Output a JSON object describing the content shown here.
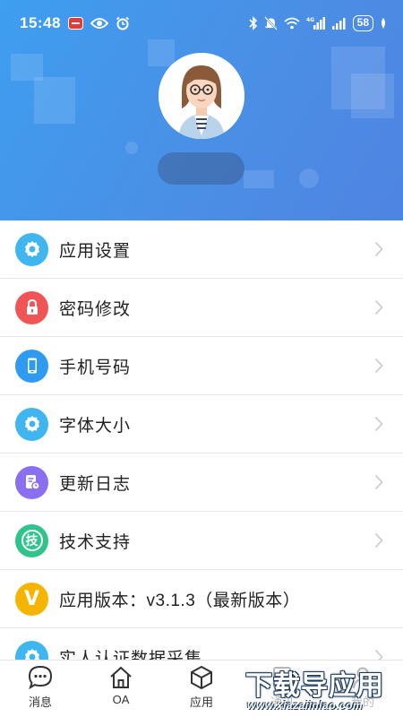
{
  "status_bar": {
    "time": "15:48",
    "battery": "58",
    "signal_label": "4G"
  },
  "profile": {
    "avatar_icon": "female-avatar-icon",
    "name": ""
  },
  "menu": {
    "items": [
      {
        "label": "应用设置",
        "icon": "gear-icon",
        "color": "#3fb6ef"
      },
      {
        "label": "密码修改",
        "icon": "lock-icon",
        "color": "#f05454"
      },
      {
        "label": "手机号码",
        "icon": "phone-icon",
        "color": "#2f9bf0"
      },
      {
        "label": "字体大小",
        "icon": "gear-icon",
        "color": "#3fb6ef"
      },
      {
        "label": "更新日志",
        "icon": "log-icon",
        "color": "#8a6ff0"
      },
      {
        "label": "技术支持",
        "icon": "support-icon",
        "color": "#2ec48a",
        "badge": "技"
      },
      {
        "label": "应用版本：v3.1.3（最新版本）",
        "icon": "version-icon",
        "color": "#f5b400",
        "badge": "V"
      },
      {
        "label": "实人认证数据采集",
        "icon": "gear-icon",
        "color": "#3fb6ef"
      }
    ]
  },
  "tabbar": {
    "tabs": [
      {
        "label": "消息",
        "icon": "chat-bubble-icon"
      },
      {
        "label": "OA",
        "icon": "home-icon"
      },
      {
        "label": "应用",
        "icon": "cube-icon"
      },
      {
        "label": "通讯",
        "icon": "contacts-icon"
      },
      {
        "label": "我的",
        "icon": "user-icon"
      }
    ]
  },
  "watermark": {
    "main": "下载导应用",
    "sub": "www.xiazaiinlao.com"
  }
}
